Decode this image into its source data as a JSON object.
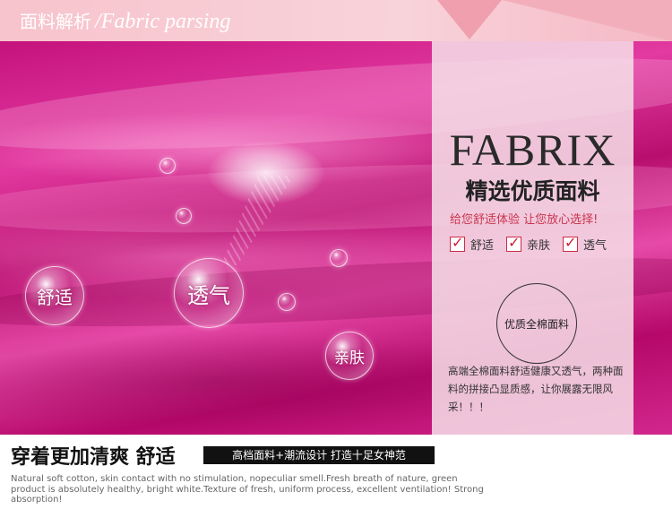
{
  "header": {
    "title_cn": "面料解析",
    "title_en": "/Fabric parsing"
  },
  "bubbles": {
    "left_label": "舒适",
    "center_label": "透气",
    "right_label": "亲肤"
  },
  "panel": {
    "logo": "FABRIX",
    "subtitle": "精选优质面料",
    "slogan": "给您舒适体验  让您放心选择!",
    "checks": [
      "舒适",
      "亲肤",
      "透气"
    ],
    "circle_text": "优质全棉面料",
    "description": "高端全棉面料舒适健康又透气，两种面料的拼接凸显质感，让你展露无限风采！！！"
  },
  "bottom": {
    "title": "穿着更加清爽 舒适",
    "bar_text": "高档面料+潮流设计  打造十足女神范",
    "english": "Natural soft cotton, skin contact with no stimulation, nopeculiar smell.Fresh breath of nature, green product is absolutely healthy, bright white.Texture of fresh, uniform process, excellent ventilation! Strong absorption!"
  },
  "colors": {
    "header_bg": "#f7c3cc",
    "fabric": "#c5127c",
    "accent_red": "#c9354e"
  }
}
